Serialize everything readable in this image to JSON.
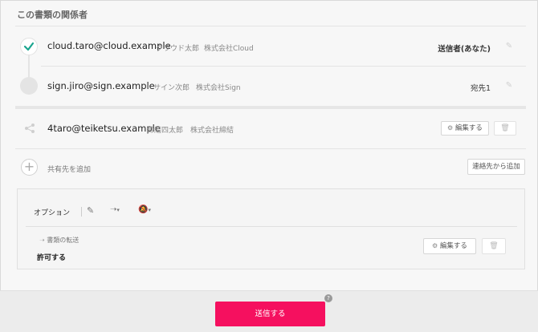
{
  "section_title": "この書類の関係者",
  "recipients": [
    {
      "email": "cloud.taro@cloud.example",
      "name": "クラウド太郎",
      "company": "株式会社Cloud",
      "role": "送信者(あなた)",
      "status_icon": "check-icon"
    },
    {
      "email": "sign.jiro@sign.example",
      "name": "サイン次郎",
      "company": "株式会社Sign",
      "role": "宛先1",
      "status_icon": "pending-circle-icon"
    }
  ],
  "shared": {
    "email": "4taro@teiketsu.example",
    "name": "締結四太郎",
    "company": "株式会社締結",
    "edit_label": "編集する",
    "icon": "share-icon"
  },
  "add_shared": {
    "label": "共有先を追加",
    "from_contacts_label": "連絡先から追加"
  },
  "options": {
    "label": "オプション",
    "forward_label": "書類の転送",
    "forward_value": "許可する",
    "edit_label": "編集する"
  },
  "footer": {
    "send_label": "送信する",
    "help_label": "?"
  },
  "colors": {
    "accent": "#f5105f",
    "check": "#1aa58f"
  }
}
